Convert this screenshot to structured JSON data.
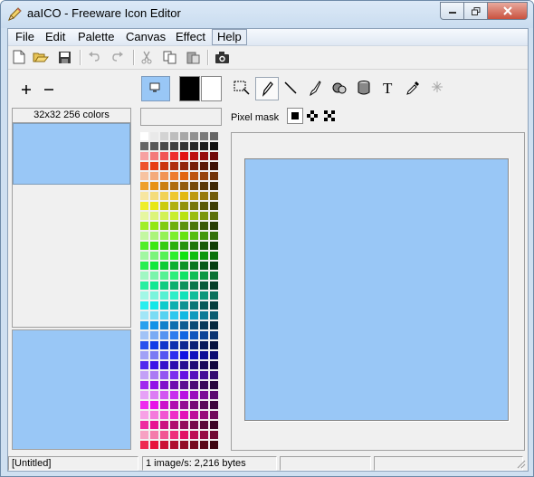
{
  "window": {
    "title": "aaICO - Freeware Icon Editor"
  },
  "menu": {
    "items": [
      {
        "label": "File"
      },
      {
        "label": "Edit"
      },
      {
        "label": "Palette"
      },
      {
        "label": "Canvas"
      },
      {
        "label": "Effect"
      },
      {
        "label": "Help"
      }
    ]
  },
  "toolbar": {
    "buttons": [
      "new-icon",
      "open-icon",
      "save-icon",
      "undo-icon",
      "redo-icon",
      "cut-icon",
      "copy-icon",
      "paste-icon",
      "camera-icon"
    ]
  },
  "icon_list": {
    "size_label": "32x32 256 colors"
  },
  "palette": {
    "foreground": "#000000",
    "background": "#ffffff",
    "preview_color": "#99c7f6"
  },
  "pixel_mask": {
    "label": "Pixel mask"
  },
  "status": {
    "file": "[Untitled]",
    "info": "1 image/s: 2,216 bytes"
  },
  "colors": {
    "accent": "#99c7f6",
    "window_border": "#6e8aa8",
    "close_button": "#c9523f"
  }
}
